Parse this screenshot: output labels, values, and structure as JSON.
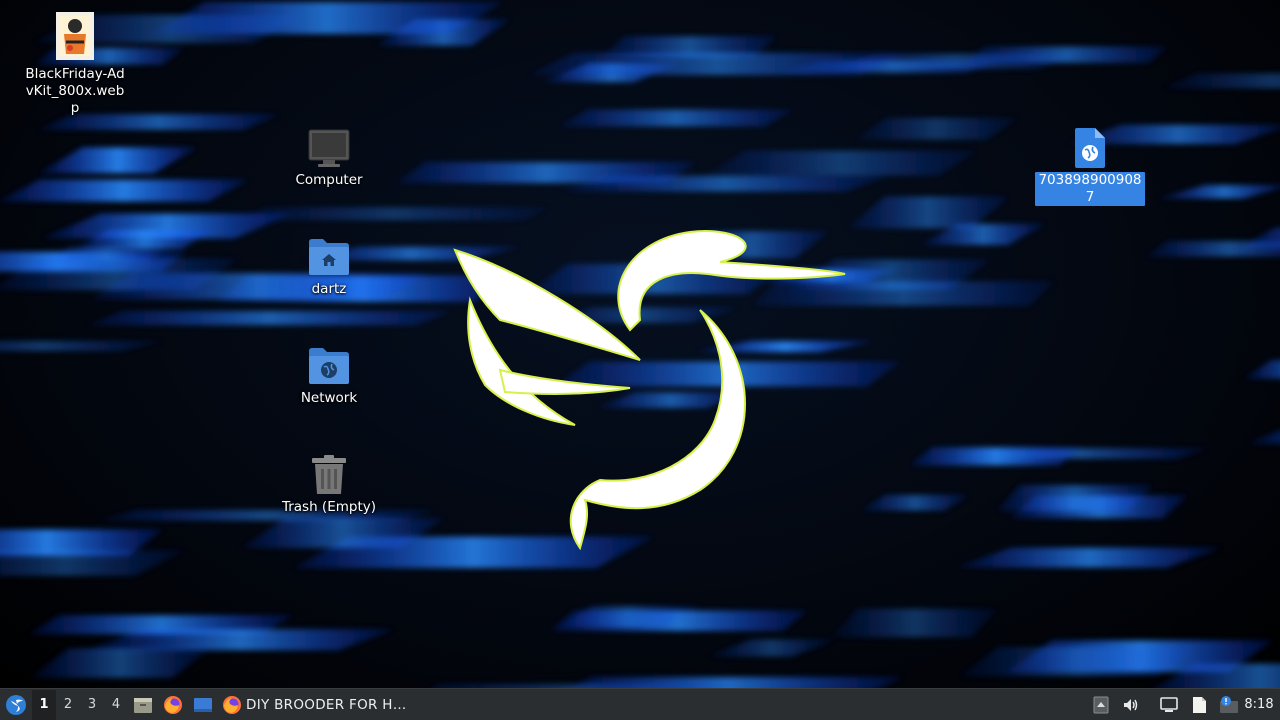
{
  "desktop": {
    "icons": [
      {
        "label": "BlackFriday-AdvKit_800x.webp",
        "type": "image-file"
      },
      {
        "label": "Computer",
        "type": "computer"
      },
      {
        "label": "dartz",
        "type": "home-folder"
      },
      {
        "label": "Network",
        "type": "network-folder"
      },
      {
        "label": "Trash (Empty)",
        "type": "trash"
      },
      {
        "label": "7038989009087",
        "type": "web-link-file",
        "selected": true
      }
    ]
  },
  "taskbar": {
    "workspaces": [
      "1",
      "2",
      "3",
      "4"
    ],
    "active_workspace": "1",
    "launchers": [
      "file-manager-icon",
      "firefox-icon",
      "desktop-icon"
    ],
    "window": {
      "title": "DIY BROODER FOR H…",
      "icon": "firefox-icon"
    },
    "tray": [
      "tray-expand-icon",
      "volume-icon",
      "network-icon",
      "clipboard-icon",
      "update-notifier-icon"
    ],
    "clock": "8:18"
  },
  "colors": {
    "taskbar_bg": "#2b2e31",
    "selection": "#3584e4",
    "folder_blue": "#5294e2",
    "wallpaper_blue": "#1a6cff"
  }
}
